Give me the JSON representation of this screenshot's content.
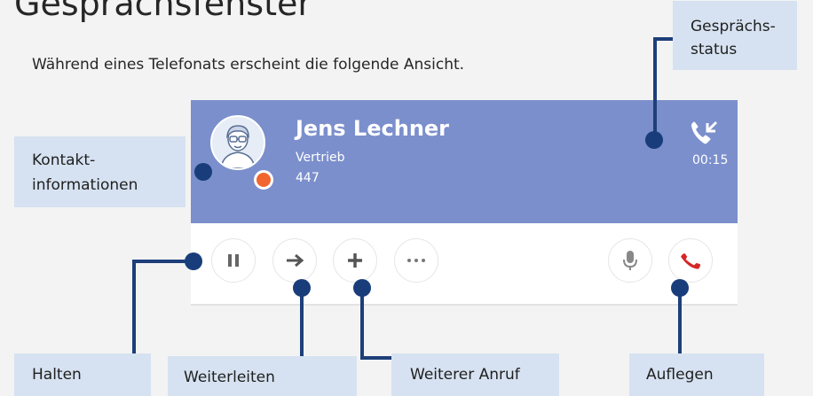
{
  "page": {
    "title": "Gesprächsfenster",
    "intro": "Während eines Telefonats erscheint die folgende Ansicht."
  },
  "call": {
    "contact_name": "Jens Lechner",
    "department": "Vertrieb",
    "extension": "447",
    "timer": "00:15",
    "status_icon": "phone-incoming-icon",
    "presence_color": "#f0662e"
  },
  "controls": {
    "hold_icon": "pause-icon",
    "forward_icon": "arrow-right-icon",
    "add_icon": "plus-icon",
    "more_icon": "more-dots-icon",
    "mute_icon": "microphone-icon",
    "hangup_icon": "hangup-icon"
  },
  "callouts": {
    "status_line1": "Gesprächs-",
    "status_line2": "status",
    "contact_line1": "Kontakt-",
    "contact_line2": "informationen",
    "hold": "Halten",
    "forward": "Weiterleiten",
    "add_call": "Weiterer Anruf",
    "hangup": "Auflegen"
  },
  "colors": {
    "header": "#7b8fcc",
    "callout_bg": "#d6e2f1",
    "pointer": "#1d3f7a",
    "hangup": "#d62626"
  }
}
